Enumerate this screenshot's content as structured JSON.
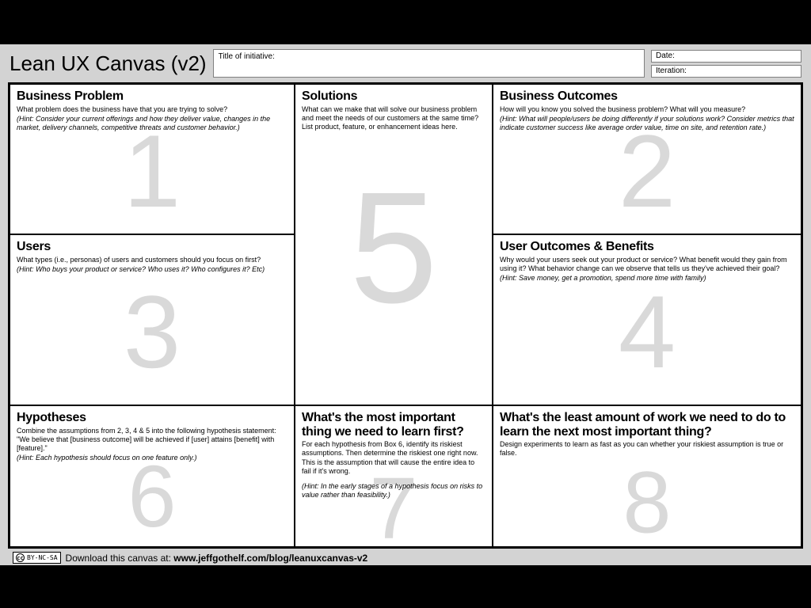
{
  "header": {
    "title": "Lean UX Canvas (v2)",
    "initiative_label": "Title of initiative:",
    "date_label": "Date:",
    "iteration_label": "Iteration:"
  },
  "boxes": {
    "b1": {
      "num": "1",
      "title": "Business Problem",
      "lead": "What problem does the business have that you are trying to solve?",
      "hint": "(Hint: Consider your current offerings and how they deliver value, changes in the market, delivery channels, competitive threats and customer behavior.)"
    },
    "b2": {
      "num": "2",
      "title": "Business Outcomes",
      "lead": "How will you know you solved the business problem? What will you measure?",
      "hint": "(Hint: What will people/users be doing differently if your solutions work? Consider metrics that indicate customer success like average order value, time on site, and retention rate.)"
    },
    "b3": {
      "num": "3",
      "title": "Users",
      "lead": "What types (i.e., personas) of users and customers should you focus on first?",
      "hint": "(Hint: Who buys your product or service? Who uses it? Who configures it? Etc)"
    },
    "b4": {
      "num": "4",
      "title": "User Outcomes & Benefits",
      "lead": "Why would your users seek out your product or service? What benefit would they gain from using it? What behavior change can we observe that tells us they've achieved their goal?",
      "hint": "(Hint: Save money, get a promotion, spend more time with family)"
    },
    "b5": {
      "num": "5",
      "title": "Solutions",
      "lead": "What can we make that will solve our business problem and meet the needs of our customers at the same time? List product, feature, or enhancement ideas here.",
      "hint": ""
    },
    "b6": {
      "num": "6",
      "title": "Hypotheses",
      "lead": "Combine the assumptions from 2, 3, 4 & 5 into the following hypothesis statement: \"We believe that [business outcome] will be achieved if [user] attains [benefit] with [feature].\"",
      "hint": "(Hint: Each hypothesis should focus on one feature only.)"
    },
    "b7": {
      "num": "7",
      "title": "What's the most important thing we need to learn first?",
      "lead": "For each hypothesis from Box 6, identify its riskiest assumptions. Then determine the riskiest one right now. This is the assumption that will cause the entire idea to fail if it's wrong.",
      "hint": "(Hint: In the early stages of a hypothesis focus on risks to value rather than feasibility.)"
    },
    "b8": {
      "num": "8",
      "title": "What's the least amount of work we need to do to learn the next most important thing?",
      "lead": "Design experiments to learn as fast as you can whether your riskiest assumption is true or false.",
      "hint": ""
    }
  },
  "footer": {
    "cc_text": "BY-NC-SA",
    "download_lead": "Download this canvas at: ",
    "download_url": "www.jeffgothelf.com/blog/leanuxcanvas-v2"
  }
}
